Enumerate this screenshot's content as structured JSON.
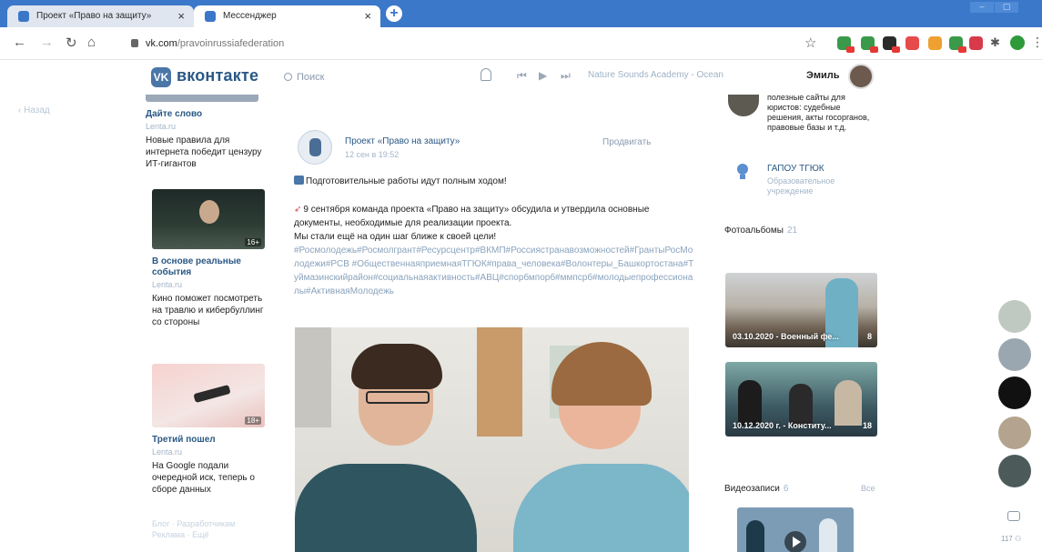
{
  "browser": {
    "tabs": [
      {
        "title": "Проект «Право на защиту»",
        "active": false
      },
      {
        "title": "Мессенджер",
        "active": true
      }
    ],
    "tab_close_symbol": "×",
    "new_tab_symbol": "+",
    "url_host": "vk.com",
    "url_path": "/pravoinrussiafederation"
  },
  "vk": {
    "logo_text": "вконтакте",
    "logo_mark": "VK",
    "search_placeholder": "Поиск",
    "player_track": "Nature Sounds Academy - Ocean",
    "user_name": "Эмиль"
  },
  "sidebar": {
    "back_label": "Назад"
  },
  "news": [
    {
      "title": "Дайте слово",
      "meta": "Lenta.ru",
      "text": "Новые правила для интернета победит цензуру ИТ-гигантов",
      "badge": ""
    },
    {
      "title": "В основе реальные события",
      "meta": "Lenta.ru",
      "text": "Кино поможет посмотреть на травлю и кибербуллинг со стороны",
      "badge": "16+"
    },
    {
      "title": "Третий пошел",
      "meta": "Lenta.ru",
      "text": "На Google подали очередной иск, теперь о сборе данных",
      "badge": "18+"
    }
  ],
  "news_footer": {
    "line1": "Блог · Разработчикам",
    "line2": "Реклама · Ещё"
  },
  "post": {
    "author": "Проект «Право на защиту»",
    "date": "12 сен в 19:52",
    "promote": "Продвигать",
    "headline": "Подготовительные работы идут полным ходом!",
    "paragraph1": "9 сентября команда проекта «Право на защиту» обсудила и утвердила основные документы, необходимые для реализации проекта.",
    "paragraph2": "Мы стали ещё на один шаг ближе к своей цели!",
    "hashtags": "#Росмолодежь#Росмолгрант#Ресурсцентр#ВКМП#Россиястранавозможностей#ГрантыРосМолодежи#РСВ #ОбщественнаяприемнаяТГЮК#права_человека#Волонтеры_Башкортостана#Туймазинскийрайон#социальнаяактивность#АВЦ#спорбмпорб#ммпсрб#молодыепрофессионалы#АктивнаяМолодежь"
  },
  "right_column": {
    "link1_text": "полезные сайты для юристов: судебные решения, акты госорганов, правовые базы и т.д.",
    "link2_name": "ГАПОУ ТГЮК",
    "link2_sub": "Образовательное учреждение",
    "albums_label": "Фотоальбомы",
    "albums_count": "21",
    "albums": [
      {
        "caption": "03.10.2020 - Военный фе...",
        "count": "8"
      },
      {
        "caption": "10.12.2020 г. - Конститу...",
        "count": "18"
      }
    ],
    "videos_label": "Видеозаписи",
    "videos_count": "6",
    "videos_all": "Все"
  },
  "rail": {
    "count_label": "117"
  },
  "colors": {
    "vk_blue": "#4a76a8",
    "link_blue": "#2a5885",
    "tab_strip": "#3b78c9",
    "muted": "#a3b5c8"
  },
  "icons": [
    "vk-logo-icon",
    "search-icon",
    "bell-icon",
    "prev-icon",
    "play-icon",
    "next-icon",
    "bulb-icon",
    "camera-icon",
    "star-icon",
    "lock-icon"
  ]
}
